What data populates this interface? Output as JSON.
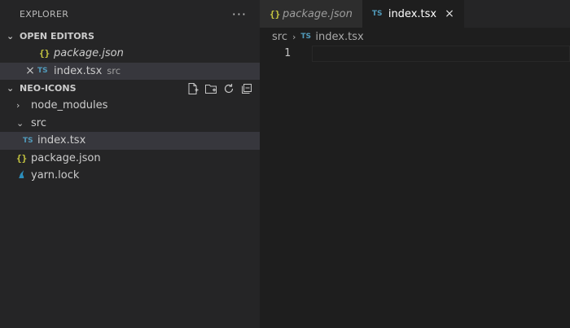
{
  "explorer": {
    "title": "EXPLORER",
    "more_actions": "···",
    "open_editors": {
      "label": "OPEN EDITORS",
      "items": [
        {
          "icon": "{}",
          "name": "package.json",
          "desc": ""
        },
        {
          "icon": "TS",
          "name": "index.tsx",
          "desc": "src",
          "close": "×"
        }
      ]
    },
    "project": {
      "label": "NEO-ICONS",
      "items": [
        {
          "chevron": "›",
          "name": "node_modules"
        },
        {
          "chevron": "⌄",
          "name": "src"
        },
        {
          "icon": "TS",
          "name": "index.tsx"
        },
        {
          "icon": "{}",
          "name": "package.json"
        },
        {
          "icon": "yarn-icon",
          "name": "yarn.lock"
        }
      ]
    }
  },
  "editor": {
    "tabs": [
      {
        "icon": "{}",
        "label": "package.json"
      },
      {
        "icon": "TS",
        "label": "index.tsx",
        "close": "×"
      }
    ],
    "breadcrumb": {
      "folder": "src",
      "sep": "›",
      "file_icon": "TS",
      "file": "index.tsx"
    },
    "line_number": "1"
  },
  "colors": {
    "json_icon": "#cbcb41",
    "ts_icon": "#519aba",
    "yarn_icon": "#2c8ebb"
  }
}
